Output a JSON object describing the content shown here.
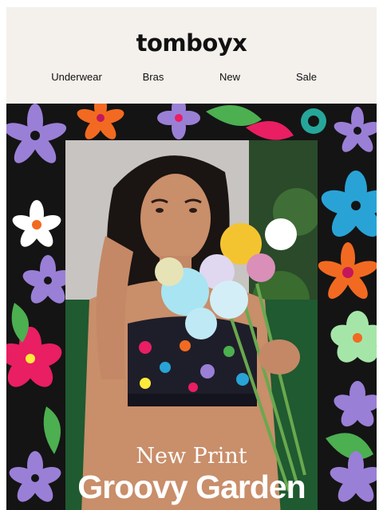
{
  "brand": {
    "logo_text": "tomboyx"
  },
  "nav": {
    "items": [
      {
        "label": "Underwear"
      },
      {
        "label": "Bras"
      },
      {
        "label": "New"
      },
      {
        "label": "Sale"
      }
    ]
  },
  "hero": {
    "eyebrow": "New Print",
    "title": "Groovy Garden",
    "colors": {
      "background": "#141414",
      "header_bg": "#f4f0ec"
    }
  }
}
